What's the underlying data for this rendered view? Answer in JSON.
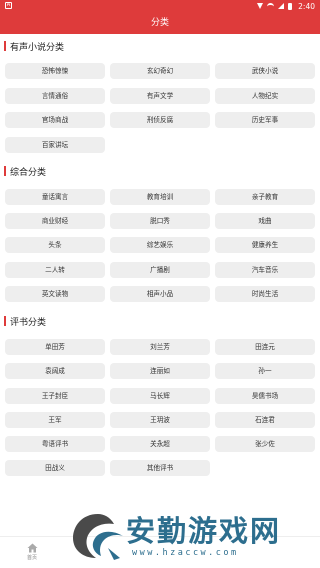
{
  "status_bar": {
    "time": "2:40",
    "left_icon": "A"
  },
  "header": {
    "title": "分类"
  },
  "sections": [
    {
      "title": "有声小说分类",
      "items": [
        "恐怖惊悚",
        "玄幻奇幻",
        "武侠小说",
        "言情通俗",
        "有声文学",
        "人物纪实",
        "官场商战",
        "刑侦反腐",
        "历史军事",
        "百家讲坛"
      ]
    },
    {
      "title": "综合分类",
      "items": [
        "童话寓言",
        "教育培训",
        "亲子教育",
        "商业财经",
        "脱口秀",
        "戏曲",
        "头条",
        "综艺娱乐",
        "健康养生",
        "二人转",
        "广播剧",
        "汽车音乐",
        "英文读物",
        "相声小品",
        "时尚生活"
      ]
    },
    {
      "title": "评书分类",
      "items": [
        "单田芳",
        "刘兰芳",
        "田连元",
        "袁阔成",
        "连丽如",
        "孙一",
        "王子封臣",
        "马长辉",
        "昊儒书场",
        "王军",
        "王玥波",
        "石连君",
        "粤语评书",
        "关永超",
        "张少佐",
        "田战义",
        "其他评书"
      ]
    }
  ],
  "tab_bar": {
    "home_label": "首页"
  },
  "watermark": {
    "brand": "安勤游戏网",
    "url": "www.hzaccw.com"
  },
  "colors": {
    "accent": "#de3b3b",
    "button_bg": "#eeeeee",
    "watermark": "#2d6e8e"
  }
}
